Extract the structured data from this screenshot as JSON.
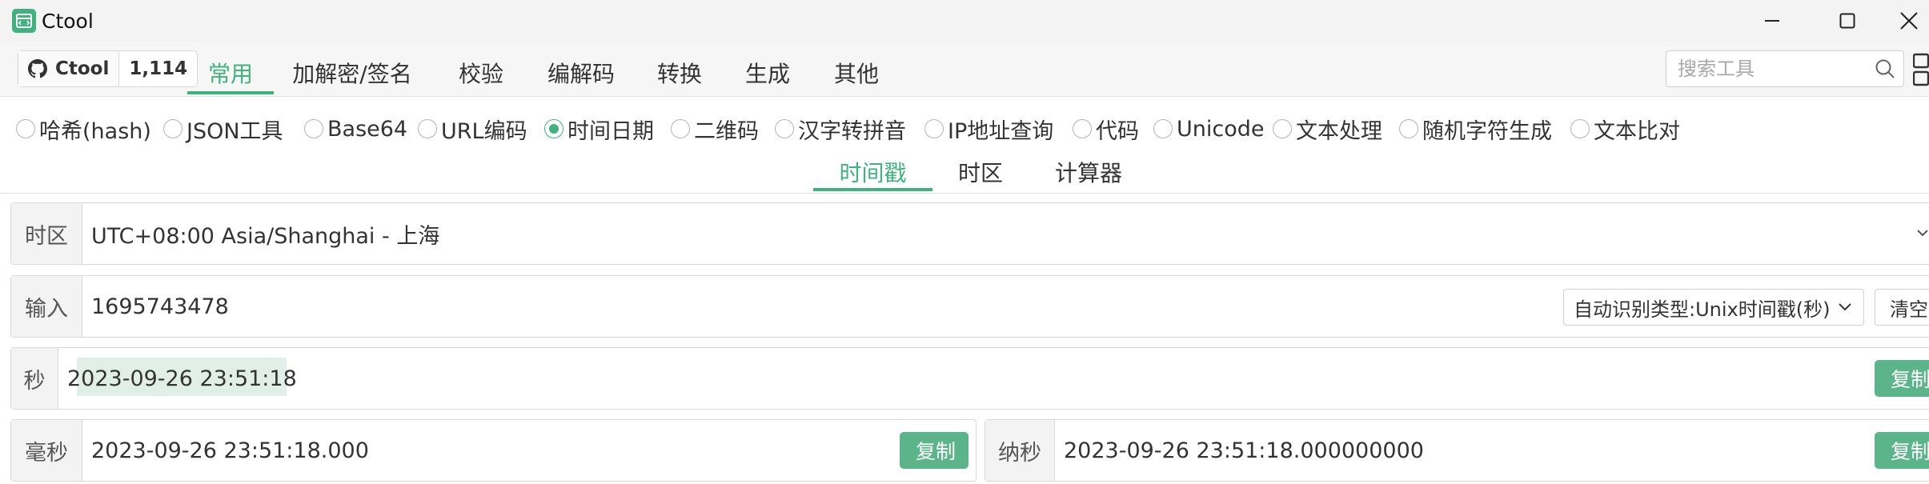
{
  "window": {
    "title": "Ctool",
    "controls": {
      "minimize_icon": "minimize-icon",
      "maximize_icon": "maximize-icon",
      "close_icon": "close-icon"
    }
  },
  "github_badge": {
    "label": "Ctool",
    "count": "1,114",
    "icon": "github-icon"
  },
  "main_tabs": [
    "常用",
    "加解密/签名",
    "校验",
    "编解码",
    "转换",
    "生成",
    "其他"
  ],
  "main_tab_active": "常用",
  "search": {
    "placeholder": "搜索工具"
  },
  "tools": [
    "哈希(hash)",
    "JSON工具",
    "Base64",
    "URL编码",
    "时间日期",
    "二维码",
    "汉字转拼音",
    "IP地址查询",
    "代码",
    "Unicode",
    "文本处理",
    "随机字符生成",
    "文本比对"
  ],
  "tool_selected": "时间日期",
  "sub_tabs": [
    "时间戳",
    "时区",
    "计算器"
  ],
  "sub_tab_active": "时间戳",
  "timezone": {
    "label": "时区",
    "value": "UTC+08:00 Asia/Shanghai - 上海"
  },
  "input": {
    "label": "输入",
    "value": "1695743478",
    "type_select": "自动识别类型:Unix时间戳(秒)",
    "clear_label": "清空"
  },
  "seconds": {
    "label": "秒",
    "value": "2023-09-26 23:51:18",
    "copy_label": "复制"
  },
  "milliseconds": {
    "label": "毫秒",
    "value": "2023-09-26 23:51:18.000",
    "copy_label": "复制"
  },
  "nanoseconds": {
    "label": "纳秒",
    "value": "2023-09-26 23:51:18.000000000",
    "copy_label": "复制"
  },
  "colors": {
    "accent": "#3fb27f",
    "copy_button": "#5cb48a",
    "label_bg": "#f3f3f3"
  }
}
